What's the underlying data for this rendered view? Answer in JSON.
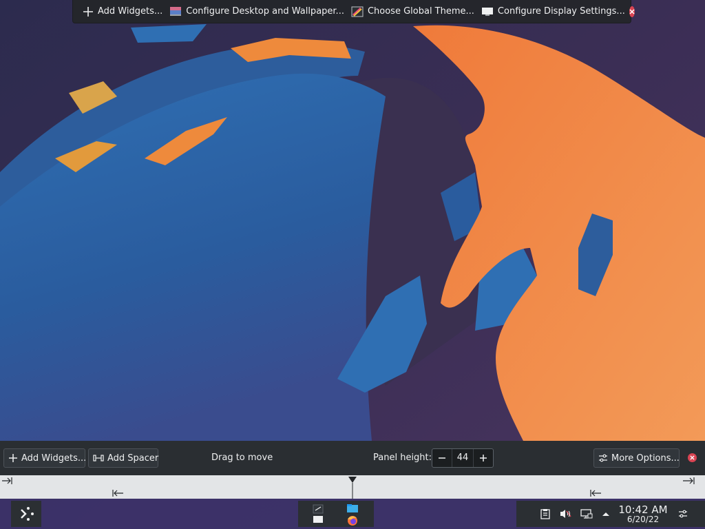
{
  "top_toolbar": {
    "add_widgets_label": "Add Widgets...",
    "configure_desktop_label": "Configure Desktop and Wallpaper...",
    "global_theme_label": "Choose Global Theme...",
    "display_settings_label": "Configure Display Settings..."
  },
  "panel_config": {
    "add_widgets_label": "Add Widgets...",
    "add_spacer_label": "Add Spacer",
    "drag_to_move_label": "Drag to move",
    "panel_height_label": "Panel height:",
    "panel_height_value": "44",
    "more_options_label": "More Options..."
  },
  "taskbar": {
    "clock_time": "10:42 AM",
    "clock_date": "6/20/22"
  },
  "colors": {
    "close_red": "#da4453",
    "panel_bg": "#2a2e32",
    "ruler_bg": "#e3e5e7",
    "taskbar_bg": "#3c3269"
  },
  "icons": {
    "top_toolbar": [
      "plus-icon",
      "desktop-wallpaper-icon",
      "global-theme-icon",
      "display-settings-icon",
      "close-icon"
    ],
    "panel_config": [
      "plus-icon",
      "spacer-icon",
      "minus-icon",
      "plus-icon",
      "more-options-icon",
      "close-icon"
    ],
    "taskbar": [
      "kickoff-icon",
      "window-switcher-icon",
      "dolphin-icon",
      "firefox-icon",
      "clipboard-icon",
      "volume-muted-icon",
      "network-icon",
      "tray-expand-icon",
      "panel-settings-icon"
    ]
  }
}
